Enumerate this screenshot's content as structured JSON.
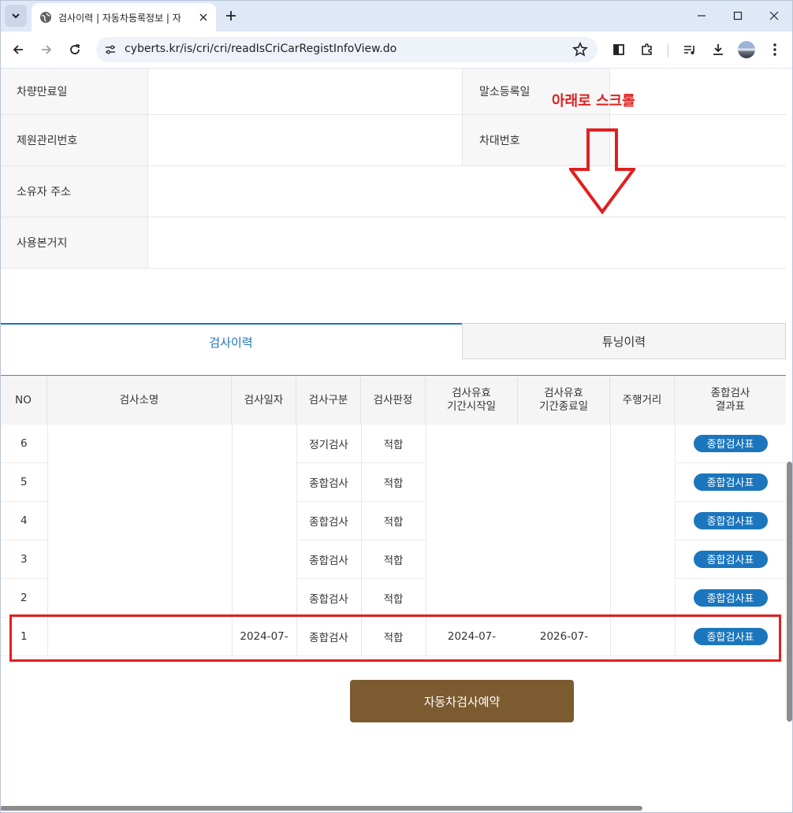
{
  "browser": {
    "tab_title": "검사이력 | 자동차등록정보 | 자",
    "url": "cyberts.kr/is/cri/cri/readIsCriCarRegistInfoView.do"
  },
  "info": {
    "rows": [
      {
        "label": "차량만료일",
        "label2": "말소등록일"
      },
      {
        "label": "제원관리번호",
        "label2": "차대번호"
      },
      {
        "label": "소유자 주소"
      },
      {
        "label": "사용본거지"
      }
    ]
  },
  "annotation": {
    "scroll_text": "아래로 스크롤",
    "color": "#e0201e"
  },
  "tabs": {
    "active": "검사이력",
    "inactive": "튜닝이력"
  },
  "table": {
    "headers": [
      "NO",
      "검사소명",
      "검사일자",
      "검사구분",
      "검사판정",
      "검사유효\n기간시작일",
      "검사유효\n기간종료일",
      "주행거리",
      "종합검사\n결과표"
    ],
    "rows": [
      {
        "no": "6",
        "type": "정기검사",
        "result": "적합",
        "date": "",
        "start": "",
        "end": "",
        "button": "종합검사표"
      },
      {
        "no": "5",
        "type": "종합검사",
        "result": "적합",
        "date": "",
        "start": "",
        "end": "",
        "button": "종합검사표"
      },
      {
        "no": "4",
        "type": "종합검사",
        "result": "적합",
        "date": "",
        "start": "",
        "end": "",
        "button": "종합검사표"
      },
      {
        "no": "3",
        "type": "종합검사",
        "result": "적합",
        "date": "",
        "start": "",
        "end": "",
        "button": "종합검사표"
      },
      {
        "no": "2",
        "type": "종합검사",
        "result": "적합",
        "date": "",
        "start": "",
        "end": "",
        "button": "종합검사표"
      },
      {
        "no": "1",
        "type": "종합검사",
        "result": "적합",
        "date": "2024-07-",
        "start": "2024-07-",
        "end": "2026-07-",
        "button": "종합검사표"
      }
    ]
  },
  "reserve_button": "자동차검사예약",
  "colors": {
    "accent": "#1b76bd",
    "reserve": "#7c5b30",
    "highlight": "#e0201e"
  }
}
